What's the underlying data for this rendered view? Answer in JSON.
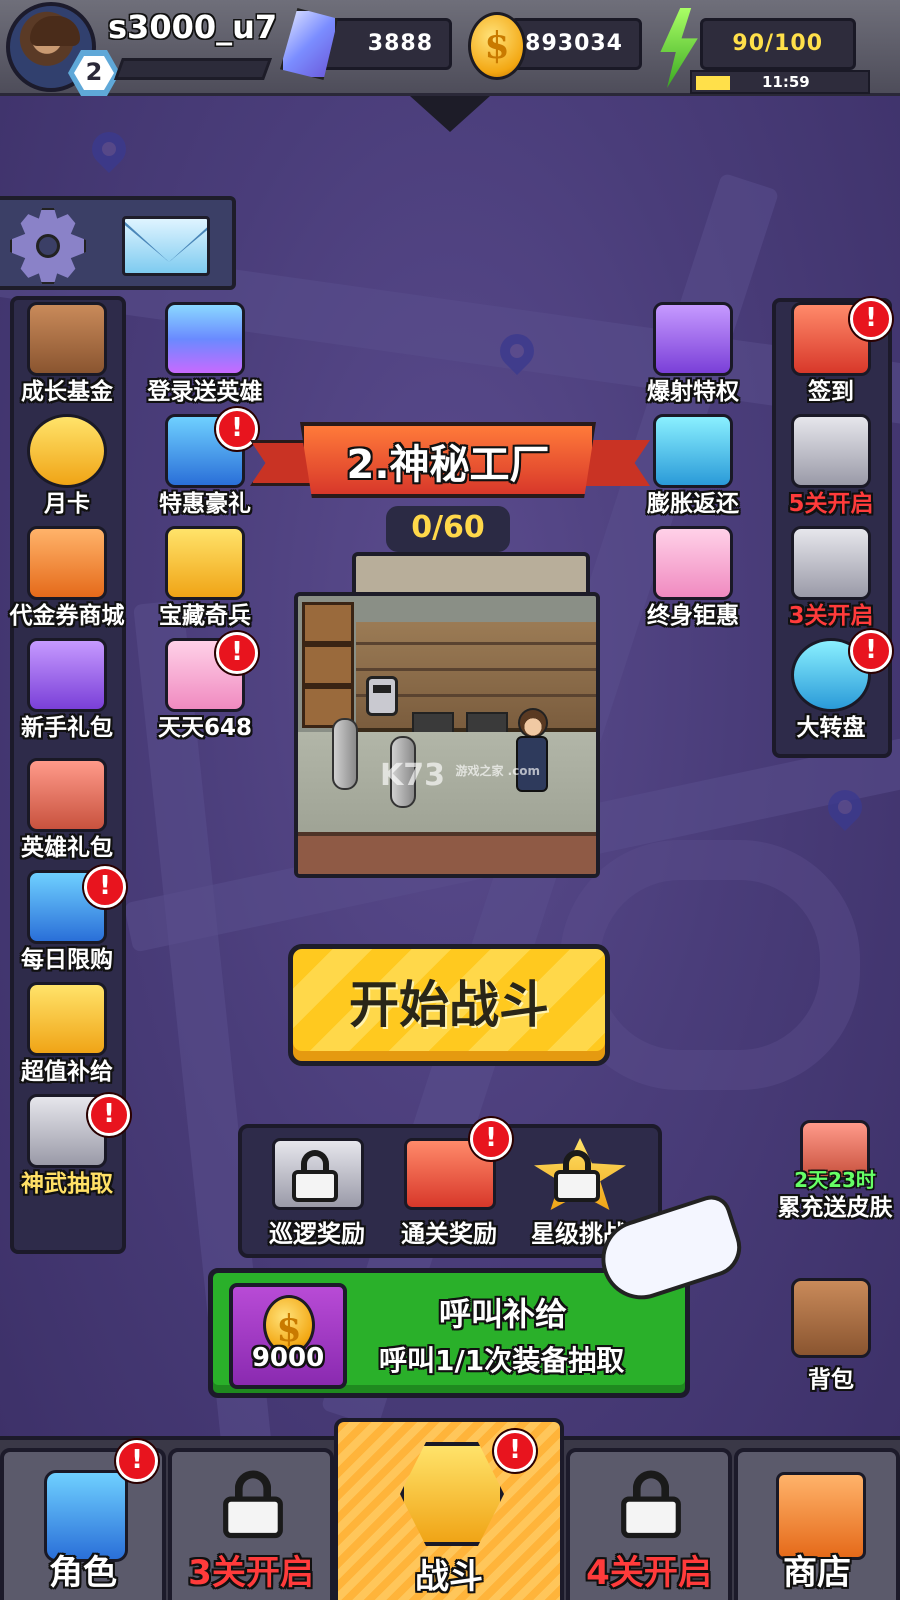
{
  "player": {
    "name": "s3000_u7",
    "level": "2"
  },
  "resources": {
    "gems": "3888",
    "coins": "893034",
    "energy": "90/100",
    "energy_timer": "11:59"
  },
  "left_menu": [
    {
      "label": "成长基金",
      "icon": "growth-fund-chest-icon"
    },
    {
      "label": "月卡",
      "icon": "monthly-card-medal-icon"
    },
    {
      "label": "代金券商城",
      "icon": "voucher-shop-icon"
    },
    {
      "label": "新手礼包",
      "icon": "newbie-gift-icon"
    },
    {
      "label": "英雄礼包",
      "icon": "hero-pack-icon"
    },
    {
      "label": "每日限购",
      "icon": "daily-limited-icon"
    },
    {
      "label": "超值补给",
      "icon": "value-supply-icon"
    },
    {
      "label": "神武抽取",
      "icon": "divine-weapon-icon"
    }
  ],
  "mid_menu": [
    {
      "label": "登录送英雄",
      "icon": "login-hero-icon"
    },
    {
      "label": "特惠豪礼",
      "icon": "special-gift-icon"
    },
    {
      "label": "宝藏奇兵",
      "icon": "treasure-soldier-icon"
    },
    {
      "label": "天天648",
      "icon": "daily-648-icon"
    }
  ],
  "right_inner_menu": [
    {
      "label": "爆射特权",
      "icon": "burst-privilege-icon"
    },
    {
      "label": "膨胀返还",
      "icon": "expansion-return-icon"
    },
    {
      "label": "终身钜惠",
      "icon": "lifetime-discount-icon"
    }
  ],
  "right_menu": [
    {
      "label": "签到",
      "icon": "calendar-icon"
    },
    {
      "label": "5关开启",
      "icon": "locked-calendar-icon"
    },
    {
      "label": "3关开启",
      "icon": "locked-notepad-icon"
    },
    {
      "label": "大转盘",
      "icon": "wheel-icon"
    }
  ],
  "level": {
    "title": "2.神秘工厂",
    "progress": "0/60",
    "watermark": "K73",
    "watermark_sub": "游戏之家 .com"
  },
  "start_button": "开始战斗",
  "rewards": [
    {
      "label": "巡逻奖励"
    },
    {
      "label": "通关奖励"
    },
    {
      "label": "星级挑战"
    }
  ],
  "recharge_promo": {
    "timer": "2天23时",
    "label": "累充送皮肤"
  },
  "supply": {
    "title": "呼叫补给",
    "subtitle": "呼叫1/1次装备抽取",
    "cost": "9000"
  },
  "backpack_label": "背包",
  "bottom_nav": [
    {
      "label": "角色"
    },
    {
      "label": "3关开启"
    },
    {
      "label": "战斗"
    },
    {
      "label": "4关开启"
    },
    {
      "label": "商店"
    }
  ],
  "colors": {
    "background": "#4a3d78",
    "accent_yellow": "#ffc91f",
    "alert_red": "#e8141e",
    "supply_green": "#2ab02a"
  }
}
